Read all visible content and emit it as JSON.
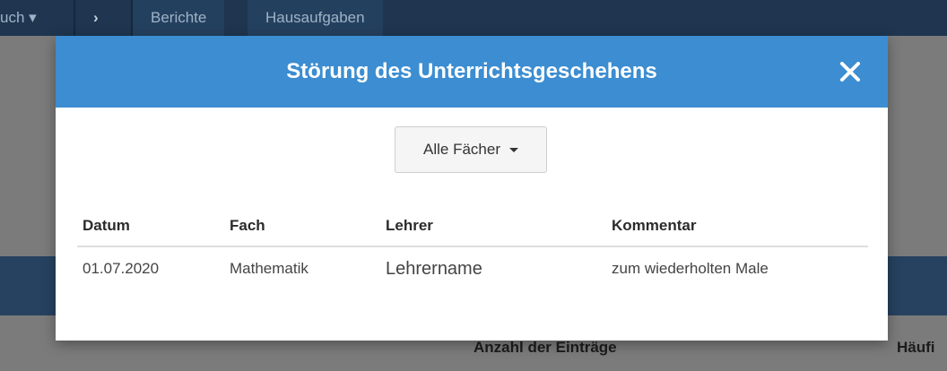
{
  "background": {
    "nav": {
      "partial_item": "uch ▾",
      "tabs": [
        "Berichte",
        "Hausaufgaben"
      ]
    },
    "footer_headers": [
      "Anzahl der Einträge",
      "Häufi"
    ]
  },
  "modal": {
    "title": "Störung des Unterrichtsgeschehens",
    "close_icon": "close-icon",
    "filter": {
      "selected": "Alle Fächer"
    },
    "table": {
      "headers": [
        "Datum",
        "Fach",
        "Lehrer",
        "Kommentar"
      ],
      "rows": [
        [
          "01.07.2020",
          "Mathematik",
          "Lehrername",
          "zum wiederholten Male"
        ]
      ]
    }
  },
  "colors": {
    "header": "#3c8dd1",
    "overlay": "#7b7b7b",
    "nav": "#1f3550"
  }
}
